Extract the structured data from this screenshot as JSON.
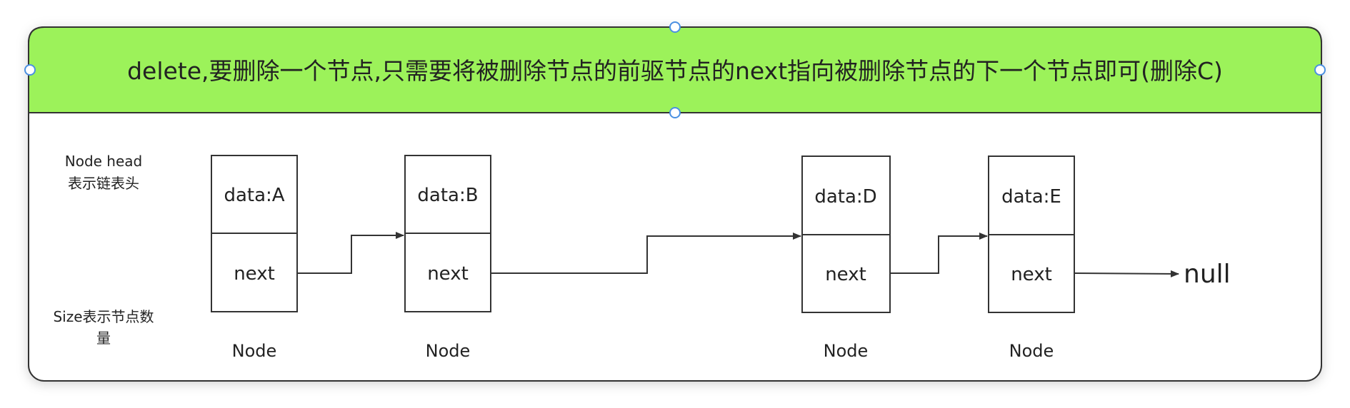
{
  "title": "delete,要删除一个节点,只需要将被删除节点的前驱节点的next指向被删除节点的下一个节点即可(删除C)",
  "left_notes": {
    "head_line1": "Node head",
    "head_line2": "表示链表头",
    "size_line1": "Size表示节点数",
    "size_line2": "量"
  },
  "nodes": [
    {
      "data": "data:A",
      "next": "next",
      "label": "Node"
    },
    {
      "data": "data:B",
      "next": "next",
      "label": "Node"
    },
    {
      "data": "data:D",
      "next": "next",
      "label": "Node"
    },
    {
      "data": "data:E",
      "next": "next",
      "label": "Node"
    }
  ],
  "null_label": "null",
  "colors": {
    "banner_fill": "#9cf25a",
    "stroke": "#333333",
    "handle": "#4a90e2",
    "text": "#222222"
  }
}
